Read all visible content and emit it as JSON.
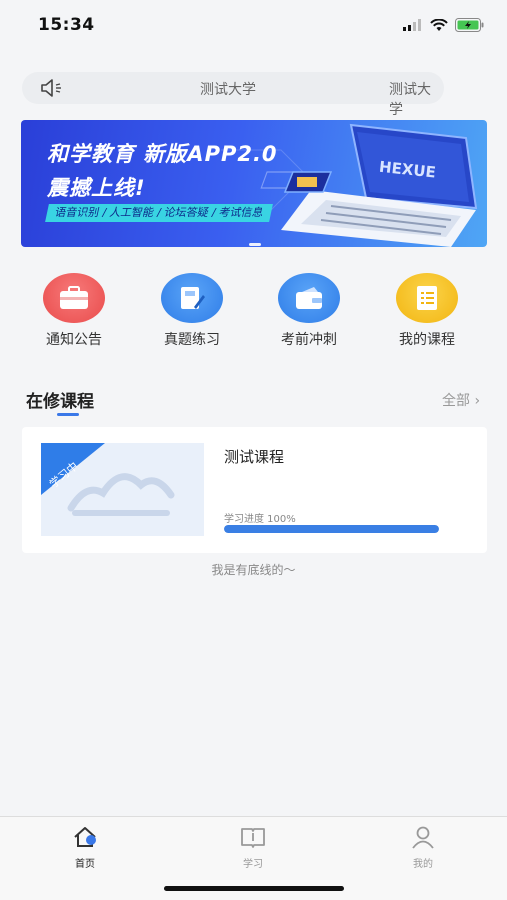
{
  "status_bar": {
    "time": "15:34"
  },
  "notice": {
    "items": [
      "测试大学",
      "测试大学"
    ]
  },
  "banner": {
    "title_line1": "和学教育 新版APP2.0",
    "title_line2": "震撼上线!",
    "tags": "语音识别 / 人工智能 / 论坛答疑 / 考试信息",
    "laptop_text": "HEXUE"
  },
  "menu": [
    {
      "label": "通知公告",
      "icon": "briefcase-icon",
      "color": "#f05a5a"
    },
    {
      "label": "真题练习",
      "icon": "book-pen-icon",
      "color": "#3d8ef0"
    },
    {
      "label": "考前冲刺",
      "icon": "wallet-icon",
      "color": "#3d8ef0"
    },
    {
      "label": "我的课程",
      "icon": "scroll-icon",
      "color": "#f5c21c"
    }
  ],
  "section": {
    "title": "在修课程",
    "more": "全部"
  },
  "course": {
    "badge": "学习中",
    "title": "测试课程",
    "progress_label": "学习进度 100%",
    "progress": 1.0
  },
  "footer_text": "我是有底线的～",
  "tabs": [
    {
      "label": "首页",
      "icon": "home-icon",
      "active": true
    },
    {
      "label": "学习",
      "icon": "book-icon",
      "active": false
    },
    {
      "label": "我的",
      "icon": "user-icon",
      "active": false
    }
  ],
  "colors": {
    "accent": "#3a78e8",
    "background": "#f4f5f7"
  }
}
